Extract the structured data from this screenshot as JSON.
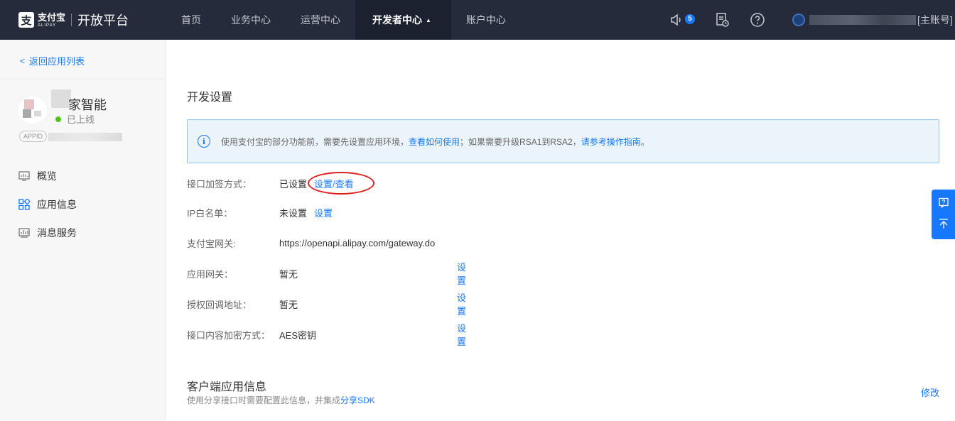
{
  "topbar": {
    "logo_cn": "支付宝",
    "logo_en": "ALIPAY",
    "platform": "开放平台",
    "nav": [
      "首页",
      "业务中心",
      "运营中心",
      "开发者中心",
      "账户中心"
    ],
    "active_nav_index": 3,
    "notification_count": "5",
    "account_suffix": "[主账号]"
  },
  "sidebar": {
    "back_label": "返回应用列表",
    "app_name": "家智能",
    "app_status": "已上线",
    "appid_badge": "APPID",
    "menu": [
      {
        "label": "概览",
        "icon": "monitor-icon"
      },
      {
        "label": "应用信息",
        "icon": "grid-icon"
      },
      {
        "label": "消息服务",
        "icon": "chart-icon"
      }
    ]
  },
  "main": {
    "section_title": "开发设置",
    "notice": {
      "prefix": "使用支付宝的部分功能前，需要先设置应用环境，",
      "link1": "查看如何使用",
      "middle": "；如果需要升级RSA1到RSA2，",
      "link2": "请参考操作指南",
      "suffix": "。"
    },
    "rows": [
      {
        "label": "接口加签方式：",
        "value": "已设置",
        "action": "设置/查看"
      },
      {
        "label": "IP白名单：",
        "value": "未设置",
        "action": "设置"
      },
      {
        "label": "支付宝网关:",
        "value": "https://openapi.alipay.com/gateway.do",
        "action": ""
      },
      {
        "label": "应用网关：",
        "value": "暂无",
        "action": "设置"
      },
      {
        "label": "授权回调地址：",
        "value": "暂无",
        "action": "设置"
      },
      {
        "label": "接口内容加密方式：",
        "value": "AES密钥",
        "action": "设置"
      }
    ],
    "client_title": "客户端应用信息",
    "client_desc": "使用分享接口时需要配置此信息，并集成",
    "client_link": "分享SDK",
    "modify_label": "修改"
  },
  "colors": {
    "topbar_bg": "#252b3a",
    "accent": "#1677ff",
    "online": "#52c41a",
    "highlight": "#e02020"
  }
}
